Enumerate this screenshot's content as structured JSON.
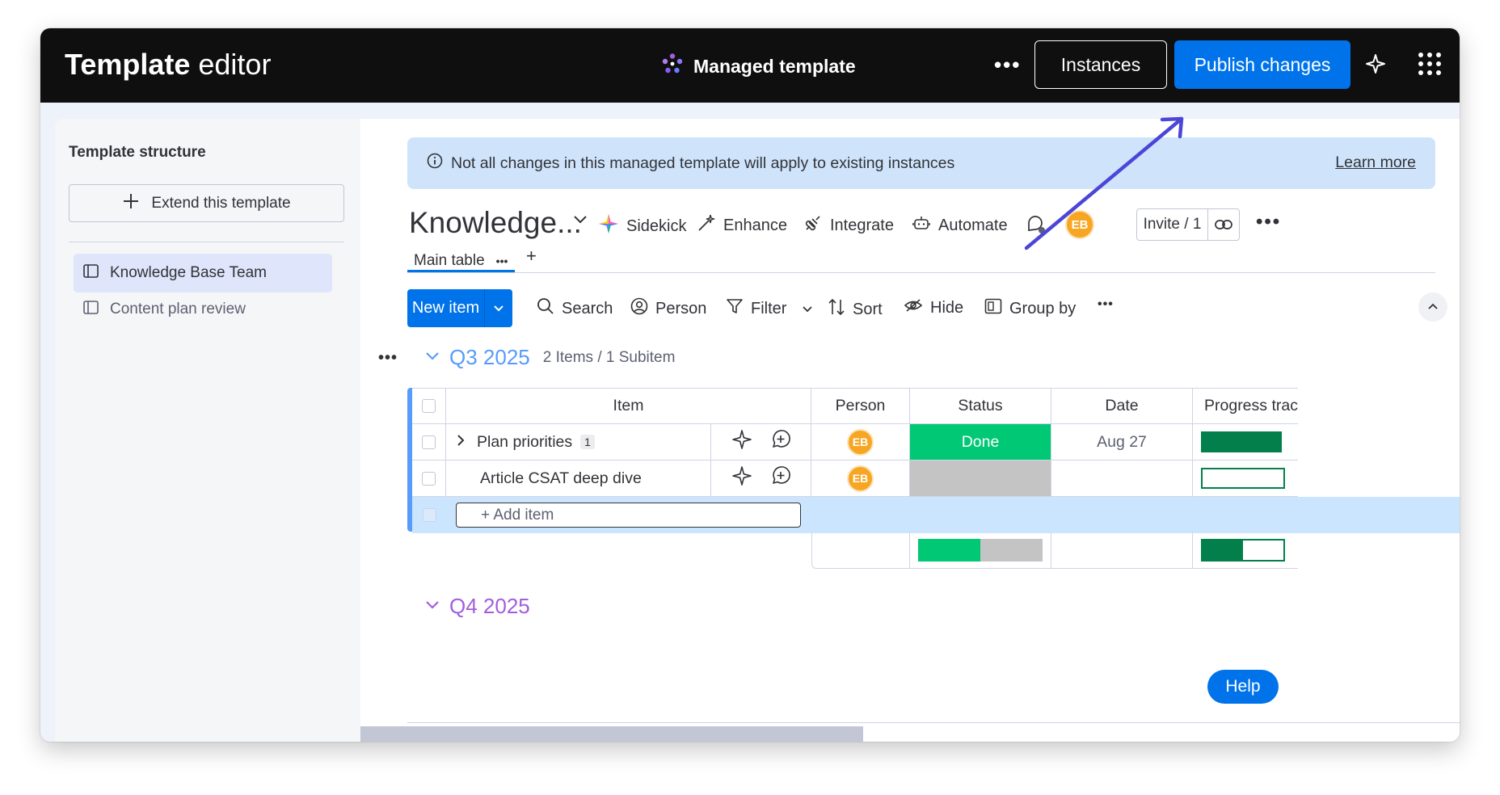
{
  "header": {
    "app_title_bold": "Template",
    "app_title_rest": "editor",
    "managed_label": "Managed template",
    "more_label": "•••",
    "instances_label": "Instances",
    "publish_label": "Publish changes"
  },
  "sidebar": {
    "title": "Template structure",
    "extend_label": "Extend this template",
    "items": [
      {
        "label": "Knowledge Base Team",
        "active": true
      },
      {
        "label": "Content plan review",
        "active": false
      }
    ]
  },
  "banner": {
    "text": "Not all changes in this managed template will apply to existing instances",
    "link": "Learn more"
  },
  "board": {
    "title": "Knowledge...",
    "tools": {
      "sidekick": "Sidekick",
      "enhance": "Enhance",
      "integrate": "Integrate",
      "automate": "Automate"
    },
    "avatar_initials": "EB",
    "invite_label": "Invite / 1",
    "more_label": "•••",
    "tab_label": "Main table",
    "tab_more": "•••",
    "tab_add": "+"
  },
  "toolbar": {
    "new_item": "New item",
    "search": "Search",
    "person": "Person",
    "filter": "Filter",
    "sort": "Sort",
    "hide": "Hide",
    "group_by": "Group by",
    "more": "•••"
  },
  "group_q3": {
    "dots": "•••",
    "title": "Q3 2025",
    "count": "2 Items / 1 Subitem",
    "columns": [
      "Item",
      "Person",
      "Status",
      "Date",
      "Progress track"
    ],
    "rows": [
      {
        "item": "Plan priorities",
        "subitems": "1",
        "person": "EB",
        "status": "Done",
        "date": "Aug 27",
        "progress": 1.0
      },
      {
        "item": "Article CSAT deep dive",
        "subitems": "",
        "person": "EB",
        "status": "",
        "date": "",
        "progress": 0.0
      }
    ],
    "add_item": "+ Add item",
    "summary_status_done_fraction": 0.5,
    "summary_progress_fraction": 0.5
  },
  "group_q4": {
    "title": "Q4 2025"
  },
  "help_label": "Help",
  "colors": {
    "header_bg": "#0f0f10",
    "primary": "#0073ea",
    "done": "#00c875",
    "progress": "#037f4c",
    "q3": "#579bfc",
    "q4": "#a25ddc",
    "annotation_arrow": "#4c46d8"
  }
}
